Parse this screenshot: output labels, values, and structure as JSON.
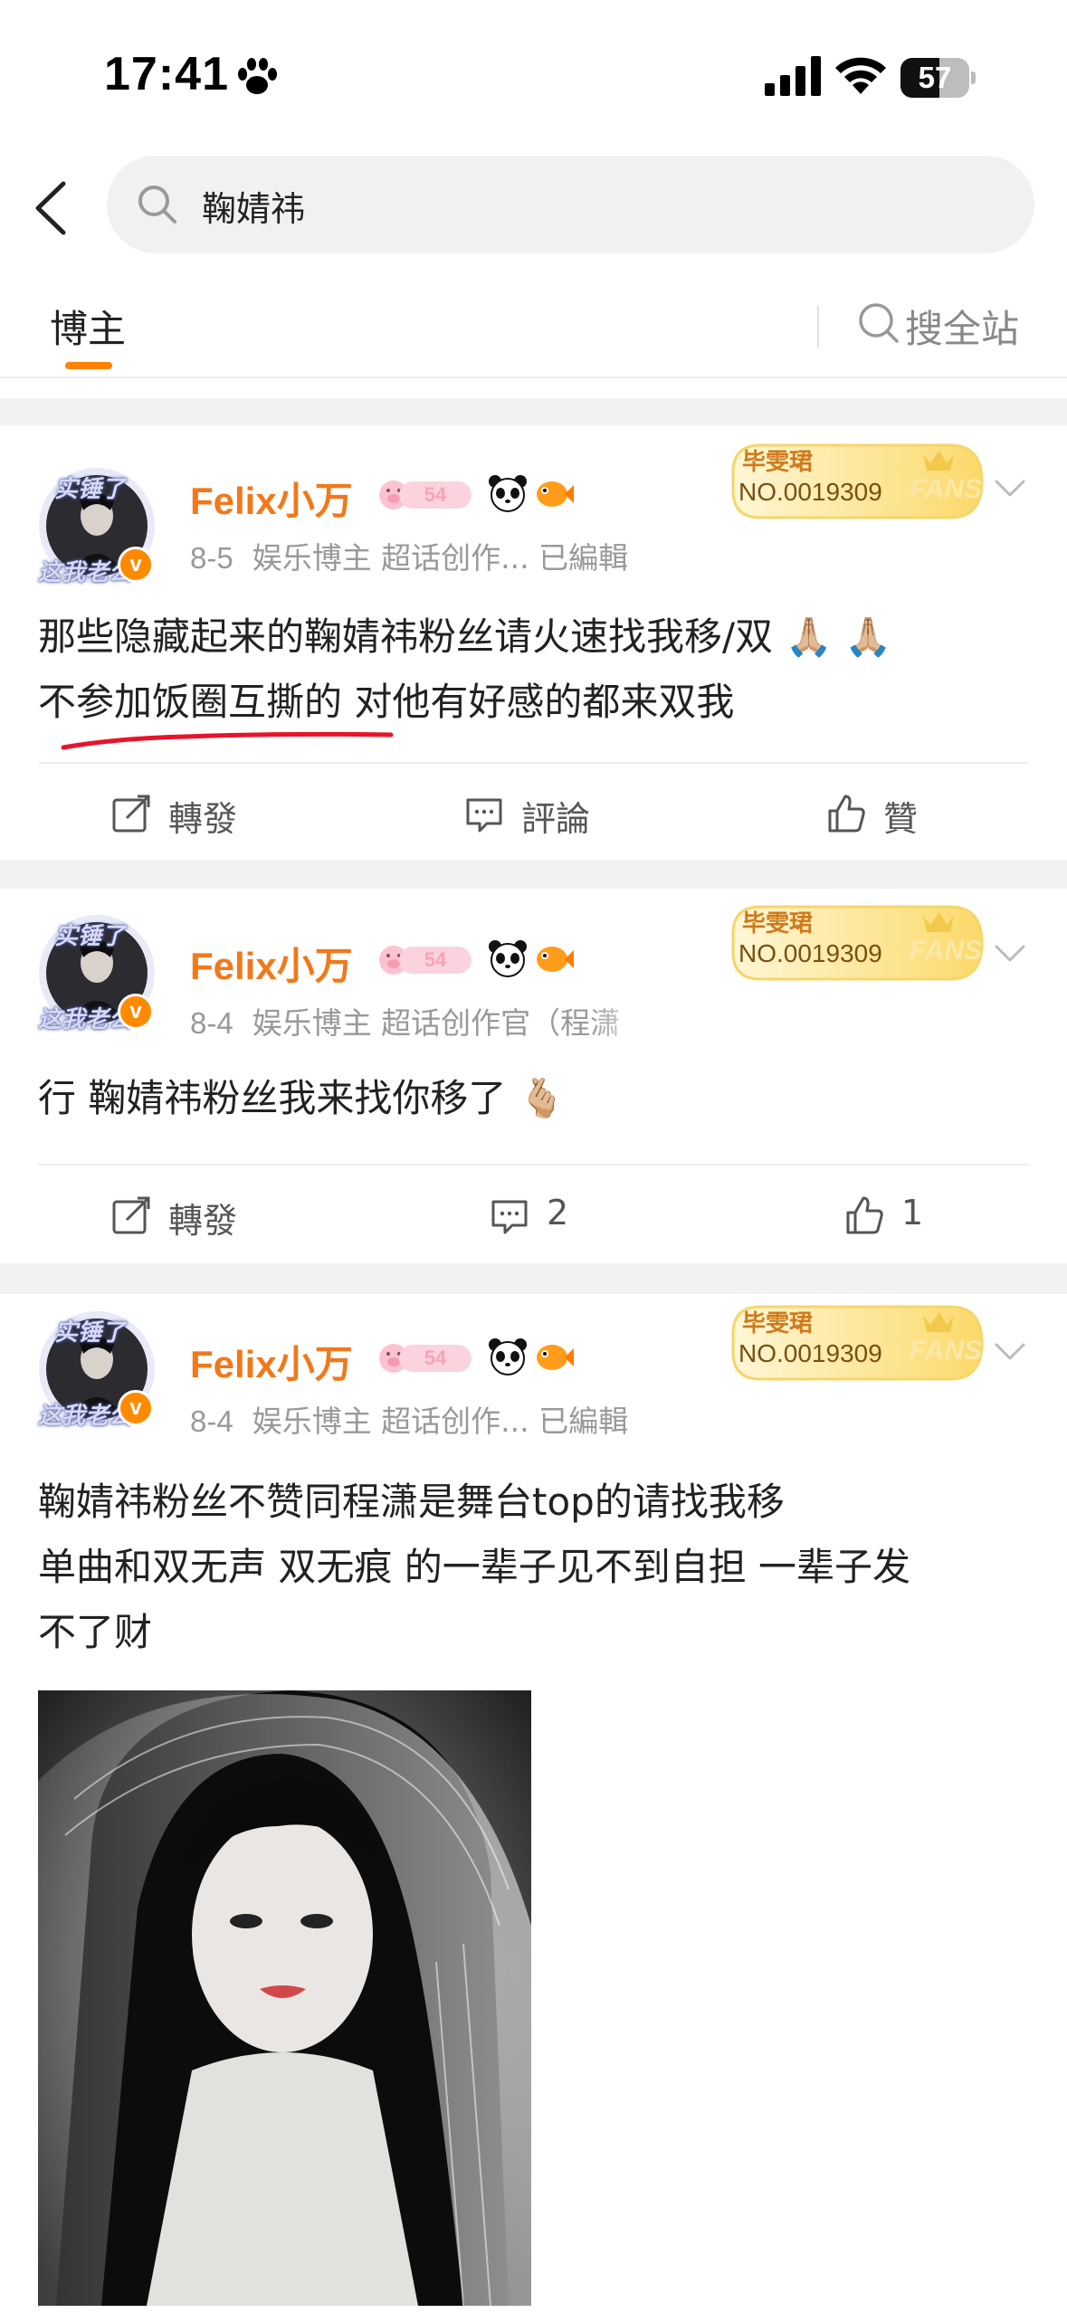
{
  "status_bar": {
    "time": "17:41",
    "battery": "57",
    "battery_level_pct": 57
  },
  "search": {
    "query": "鞠婧祎"
  },
  "tabs": {
    "active": "博主",
    "search_site": "搜全站"
  },
  "posts": [
    {
      "username": "Felix小万",
      "level": "54",
      "avatar_text_top": "实锤了",
      "avatar_text_bottom": "这我老公",
      "fan_badge_name": "毕雯珺",
      "fan_badge_no": "NO.0019309",
      "fan_badge_word": "FANS",
      "date": "8-5",
      "meta": "娱乐博主 超话创作... 已編輯",
      "text_line1": "那些隐藏起来的鞠婧祎粉丝请火速找我移/双 🙏🏼 🙏🏼",
      "text_line2": "不参加饭圈互撕的 对他有好感的都来双我",
      "repost": "轉發",
      "comment": "評論",
      "like": "贊"
    },
    {
      "username": "Felix小万",
      "level": "54",
      "avatar_text_top": "实锤了",
      "avatar_text_bottom": "这我老公",
      "fan_badge_name": "毕雯珺",
      "fan_badge_no": "NO.0019309",
      "fan_badge_word": "FANS",
      "date": "8-4",
      "meta": "娱乐博主 超话创作官（程潇",
      "text_line1": "行 鞠婧祎粉丝我来找你移了 🫰🏼",
      "repost": "轉發",
      "comment": "2",
      "like": "1"
    },
    {
      "username": "Felix小万",
      "level": "54",
      "avatar_text_top": "实锤了",
      "avatar_text_bottom": "这我老公",
      "fan_badge_name": "毕雯珺",
      "fan_badge_no": "NO.0019309",
      "fan_badge_word": "FANS",
      "date": "8-4",
      "meta": "娱乐博主 超话创作... 已編輯",
      "text_line1": "鞠婧祎粉丝不赞同程潇是舞台top的请找我移",
      "text_line2": "单曲和双无声 双无痕 的一辈子见不到自担 一辈子发",
      "text_line3": "不了财"
    }
  ],
  "colors": {
    "accent": "#ff8200",
    "username": "#f2781a",
    "meta": "#999999",
    "divider": "#f2f2f2",
    "annotation_line": "#e8142a"
  }
}
